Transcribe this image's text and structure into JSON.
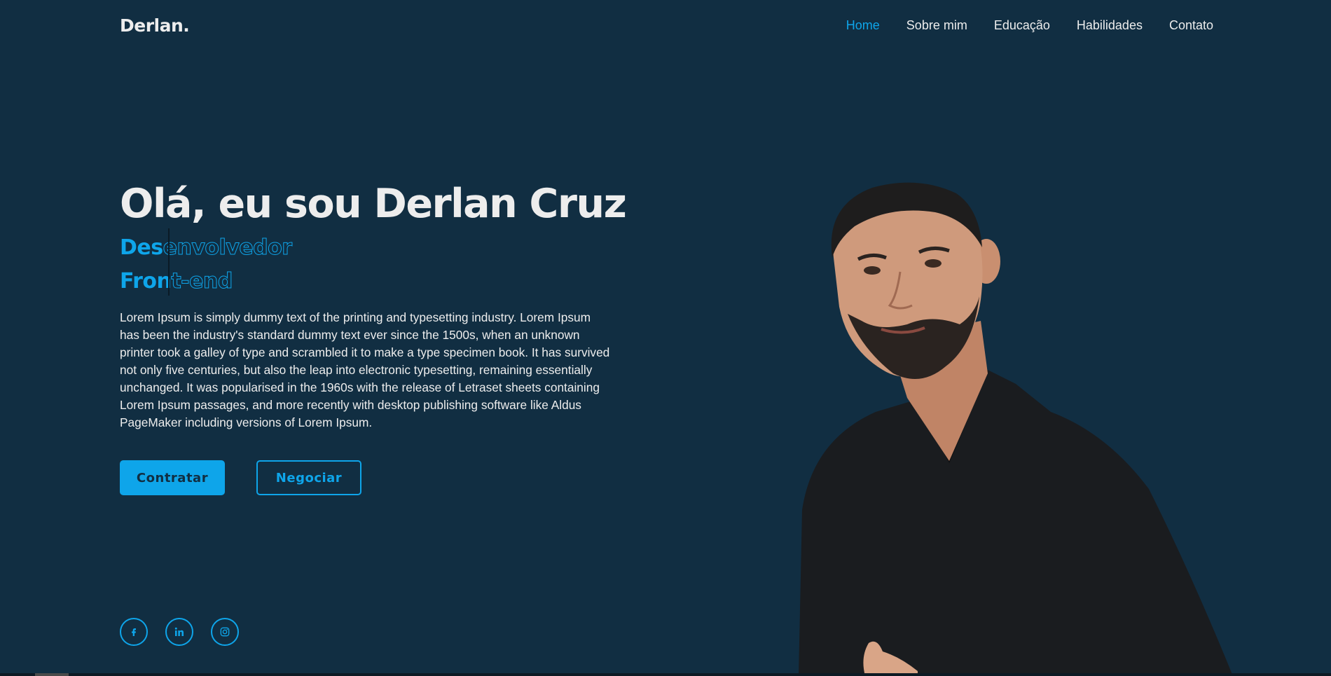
{
  "header": {
    "logo": "Derlan.",
    "nav": [
      {
        "label": "Home",
        "active": true
      },
      {
        "label": "Sobre mim",
        "active": false
      },
      {
        "label": "Educação",
        "active": false
      },
      {
        "label": "Habilidades",
        "active": false
      },
      {
        "label": "Contato",
        "active": false
      }
    ]
  },
  "hero": {
    "title": "Olá, eu sou Derlan Cruz",
    "typing": {
      "line1_filled": "Des",
      "line1_outline": "envolvedor",
      "line2_filled": "Fron",
      "line2_outline": "t-end"
    },
    "description": "Lorem Ipsum is simply dummy text of the printing and typesetting industry. Lorem Ipsum has been the industry's standard dummy text ever since the 1500s, when an unknown printer took a galley of type and scrambled it to make a type specimen book. It has survived not only five centuries, but also the leap into electronic typesetting, remaining essentially unchanged. It was popularised in the 1960s with the release of Letraset sheets containing Lorem Ipsum passages, and more recently with desktop publishing software like Aldus PageMaker including versions of Lorem Ipsum.",
    "buttons": {
      "primary": "Contratar",
      "secondary": "Negociar"
    }
  },
  "social": [
    {
      "icon": "facebook-icon"
    },
    {
      "icon": "linkedin-icon"
    },
    {
      "icon": "instagram-icon"
    }
  ],
  "colors": {
    "background": "#112e42",
    "accent": "#0ea5ea",
    "text": "#ededed"
  }
}
